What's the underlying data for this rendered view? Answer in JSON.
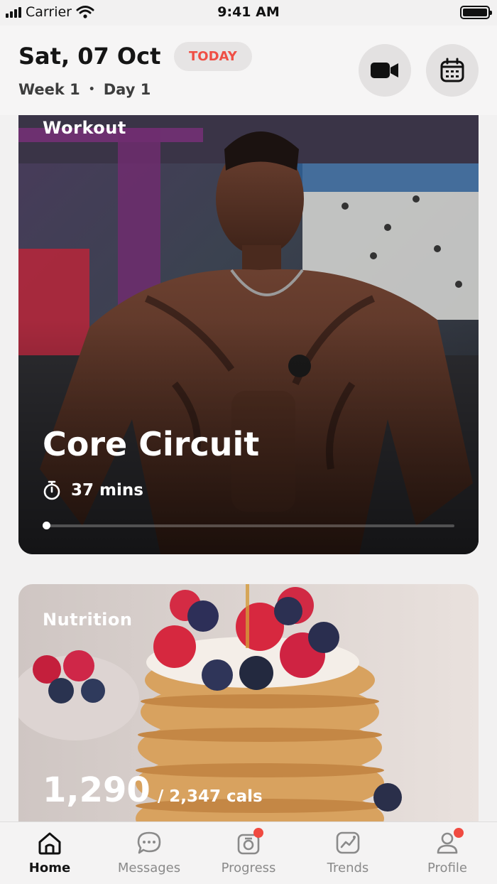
{
  "status_bar": {
    "carrier": "Carrier",
    "time": "9:41 AM"
  },
  "header": {
    "date": "Sat, 07 Oct",
    "today_label": "TODAY",
    "week": "Week 1",
    "separator": "•",
    "day": "Day 1"
  },
  "workout": {
    "label": "Workout",
    "title": "Core Circuit",
    "duration": "37 mins",
    "progress": 0.0
  },
  "nutrition": {
    "label": "Nutrition",
    "calories": "1,290",
    "target": "/ 2,347 cals"
  },
  "tabs": [
    {
      "label": "Home",
      "icon": "home-icon",
      "active": true
    },
    {
      "label": "Messages",
      "icon": "chat-icon",
      "active": false
    },
    {
      "label": "Progress",
      "icon": "camera-icon",
      "badge": true
    },
    {
      "label": "Trends",
      "icon": "chart-icon",
      "active": false
    },
    {
      "label": "Profile",
      "icon": "user-icon",
      "badge": true
    }
  ],
  "colors": {
    "accent": "#ef4f45",
    "badge": "#f04a40",
    "text": "#151515"
  }
}
